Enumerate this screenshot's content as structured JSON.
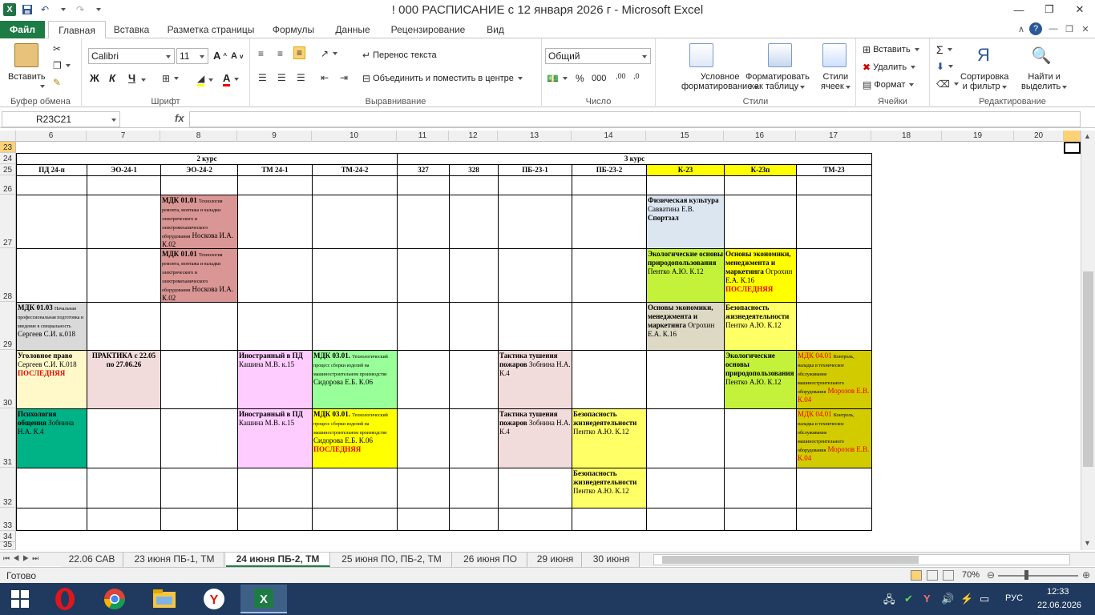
{
  "window": {
    "title": "! 000 РАСПИСАНИЕ с 12 января 2026 г  -  Microsoft Excel",
    "app_icon_letter": "X"
  },
  "ribbon_tabs": [
    "Файл",
    "Главная",
    "Вставка",
    "Разметка страницы",
    "Формулы",
    "Данные",
    "Рецензирование",
    "Вид"
  ],
  "ribbon": {
    "paste": "Вставить",
    "clipboard_group": "Буфер обмена",
    "font_name": "Calibri",
    "font_size": "11",
    "bold": "Ж",
    "italic": "К",
    "underline": "Ч",
    "font_group": "Шрифт",
    "wrap_text": "Перенос текста",
    "merge_center": "Объединить и поместить в центре",
    "alignment_group": "Выравнивание",
    "number_format": "Общий",
    "percent": "%",
    "thousands": "000",
    "number_group": "Число",
    "cond_format_1": "Условное",
    "cond_format_2": "форматирование",
    "format_table_1": "Форматировать",
    "format_table_2": "как таблицу",
    "cell_styles_1": "Стили",
    "cell_styles_2": "ячеек",
    "styles_group": "Стили",
    "insert": "Вставить",
    "delete": "Удалить",
    "format": "Формат",
    "cells_group": "Ячейки",
    "sort_1": "Сортировка",
    "sort_2": "и фильтр",
    "find_1": "Найти и",
    "find_2": "выделить",
    "editing_group": "Редактирование"
  },
  "formula_bar": {
    "name_box": "R23C21",
    "fx": "fx",
    "value": ""
  },
  "columns": [
    "6",
    "7",
    "8",
    "9",
    "10",
    "11",
    "12",
    "13",
    "14",
    "15",
    "16",
    "17",
    "18",
    "19",
    "20"
  ],
  "rows": [
    "23",
    "24",
    "25",
    "26",
    "27",
    "28",
    "29",
    "30",
    "31",
    "32",
    "33",
    "34",
    "35"
  ],
  "schedule": {
    "course2": "2 курс",
    "course3": "3 курс",
    "groups": [
      "ПД 24-п",
      "ЭО-24-1",
      "ЭО-24-2",
      "ТМ 24-1",
      "ТМ-24-2",
      "327",
      "328",
      "ПБ-23-1",
      "ПБ-23-2",
      "К-23",
      "К-23п",
      "ТМ-23"
    ],
    "c_r27_eo242_title": "МДК 01.01",
    "c_r27_eo242_desc": "Технология ремонта, монтажа и наладки электрического и электромеханического оборудования",
    "c_r27_eo242_teacher": "Носкова И.А. К.02",
    "c_r27_k23_title": "Физическая культура",
    "c_r27_k23_teacher": "Савватина Е.В.",
    "c_r27_k23_room": "Спортзал",
    "c_r28_eo242_title": "МДК 01.01",
    "c_r28_eo242_desc": "Технология ремонта, монтажа и наладки электрического и электромеханического оборудования",
    "c_r28_eo242_teacher": "Носкова И.А. К.02",
    "c_r28_k23_title": "Экологические основы природопользования",
    "c_r28_k23_teacher": "Пентко А.Ю. К.12",
    "c_r28_k23p_title": "Основы экономики, менеджмента и маркетинга",
    "c_r28_k23p_teacher": "Огрохин Е.А. К.16",
    "c_r28_k23p_last": "ПОСЛЕДНЯЯ",
    "c_r29_pd_title": "МДК 01.03",
    "c_r29_pd_desc": "Начальная профессиональная подготовка и введение в специальность",
    "c_r29_pd_teacher": "Сергеев С.И. к.018",
    "c_r29_k23_title": "Основы экономики, менеджмента и маркетинга",
    "c_r29_k23_teacher": "Огрохин Е.А. К.16",
    "c_r29_k23p_title": "Безопасность жизнедеятельности",
    "c_r29_k23p_teacher": "Пентко А.Ю. К.12",
    "c_r30_pd_title": "Уголовное право",
    "c_r30_pd_teacher": "Сергеев С.И. К.018",
    "c_r30_pd_last": "ПОСЛЕДНЯЯ",
    "c_r30_eo241": "ПРАКТИКА  с 22.05 по 27.06.26",
    "c_r30_tm241_title": "Иностранный в ПД",
    "c_r30_tm241_teacher": "Кашина М.В. к.15",
    "c_r30_tm242_title": "МДК 03.01.",
    "c_r30_tm242_desc": "Технологический процесс сборки изделий на машиностроительном производстве",
    "c_r30_tm242_teacher": "Сидорова Е.Б. К.06",
    "c_r30_pb231_title": "Тактика тушения пожаров",
    "c_r30_pb231_teacher": "Зобнина Н.А. К.4",
    "c_r30_k23p_title": "Экологические основы природопользования",
    "c_r30_k23p_teacher": "Пентко А.Ю. К.12",
    "c_r30_tm23_title": "МДК 04.01",
    "c_r30_tm23_desc": "Контроль, наладка и техническое обслуживание машиностроительного оборудования",
    "c_r30_tm23_teacher": "Морозов Е.В. К.04",
    "c_r31_pd_title": "Психология общения",
    "c_r31_pd_teacher": "Зобнина Н.А. К.4",
    "c_r31_tm241_title": "Иностранный в ПД",
    "c_r31_tm241_teacher": "Кашина М.В. к.15",
    "c_r31_tm242_title": "МДК 03.01.",
    "c_r31_tm242_desc": "Технологический процесс сборки изделий на машиностроительном производстве",
    "c_r31_tm242_teacher": "Сидорова Е.Б. К.06",
    "c_r31_tm242_last": "ПОСЛЕДНЯЯ",
    "c_r31_pb231_title": "Тактика тушения пожаров",
    "c_r31_pb231_teacher": "Зобнина Н.А. К.4",
    "c_r31_pb232_title": "Безопасность жизнедеятельности",
    "c_r31_pb232_teacher": "Пентко А.Ю. К.12",
    "c_r31_tm23_title": "МДК 04.01",
    "c_r31_tm23_desc": "Контроль, наладка и техническое обслуживание машиностроительного оборудования",
    "c_r31_tm23_teacher": "Морозов Е.В. К.04",
    "c_r32_pb232_title": "Безопасность жизнедеятельности",
    "c_r32_pb232_teacher": "Пентко А.Ю. К.12"
  },
  "sheets": [
    "22.06 САВ",
    "23 июня ПБ-1, ТМ",
    "24 июня ПБ-2, ТМ",
    "25 июня ПО, ПБ-2, ТМ",
    "26 июня ПО",
    "29 июня",
    "30 июня"
  ],
  "status": {
    "ready": "Готово",
    "zoom": "70%",
    "zoom_fraction": 0.7
  },
  "taskbar": {
    "lang": "РУС",
    "time": "12:33",
    "date": "22.06.2026"
  },
  "colors": {
    "excel_green": "#1d7b45",
    "pink": "#da9694",
    "lightblue": "#dce6f1",
    "lime": "#c4f23a",
    "yellow": "#ffff00",
    "gray": "#d9d9d9",
    "cream": "#fff9c9",
    "rose": "#f2dcdb",
    "magenta_light": "#ffccff",
    "green_light": "#99ff99",
    "teal": "#00b386",
    "olive": "#d2cb00",
    "khaki": "#ddd9c4",
    "yellow_soft": "#ffff66"
  }
}
